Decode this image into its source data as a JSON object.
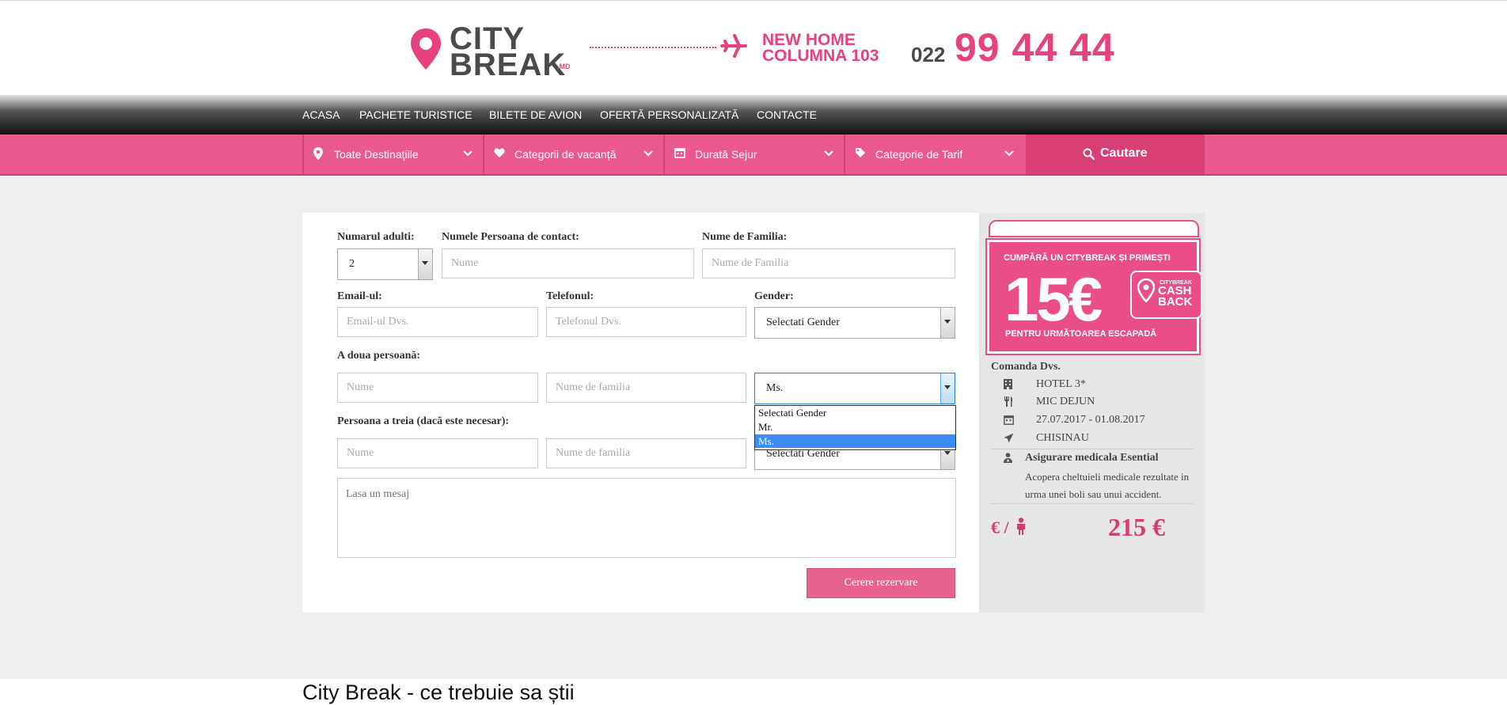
{
  "brand": {
    "logo_line1": "CITY",
    "logo_line2": "BREAK",
    "logo_suffix": ".MD",
    "accent_color": "#e7417f",
    "address_line1": "NEW HOME",
    "address_line2": "COLUMNA 103",
    "phone_prefix": "022",
    "phone_number": "99 44 44"
  },
  "nav": {
    "items": [
      "ACASA",
      "PACHETE TURISTICE",
      "BILETE DE AVION",
      "OFERTĂ PERSONALIZATĂ",
      "CONTACTE"
    ]
  },
  "filters": {
    "items": [
      {
        "label": "Toate Destinaţiile",
        "icon": "map-marker-icon"
      },
      {
        "label": "Categorii de vacanță",
        "icon": "heart-icon"
      },
      {
        "label": "Durată Sejur",
        "icon": "calendar-icon"
      },
      {
        "label": "Categorie de Tarif",
        "icon": "tag-icon"
      }
    ],
    "search_label": "Cautare"
  },
  "form": {
    "adults_label": "Numarul adulti:",
    "adults_value": "2",
    "contact_name_label": "Numele Persoana de contact:",
    "contact_name_placeholder": "Nume",
    "family_name_label": "Nume de Familia:",
    "family_name_placeholder": "Nume de Familia",
    "email_label": "Email-ul:",
    "email_placeholder": "Email-ul Dvs.",
    "phone_label": "Telefonul:",
    "phone_placeholder": "Telefonul Dvs.",
    "gender_label": "Gender:",
    "gender_value": "Selectati Gender",
    "second_person_label": "A doua persoană:",
    "second_name_placeholder": "Nume",
    "second_family_placeholder": "Nume de familia",
    "second_gender_value": "Ms.",
    "gender_options": [
      "Selectati Gender",
      "Mr.",
      "Ms."
    ],
    "third_person_label": "Persoana a treia (dacă este necesar):",
    "third_name_placeholder": "Nume",
    "third_family_placeholder": "Nume de familia",
    "third_gender_value": "Selectati Gender",
    "message_placeholder": "Lasa un mesaj",
    "submit_label": "Cerere rezervare"
  },
  "banner": {
    "top_text": "CUMPĂRĂ UN CITYBREAK ȘI PRIMEȘTI",
    "amount": "15€",
    "cashback_small": "CITYBREAK",
    "cashback_line1": "CASH",
    "cashback_line2": "BACK",
    "bottom_text": "PENTRU URMĂTOAREA ESCAPADĂ"
  },
  "order": {
    "title": "Comanda Dvs.",
    "items": [
      {
        "icon": "building-icon",
        "text": "HOTEL 3*"
      },
      {
        "icon": "cutlery-icon",
        "text": "MIC DEJUN"
      },
      {
        "icon": "calendar-icon",
        "text": "27.07.2017 - 01.08.2017"
      },
      {
        "icon": "plane-icon",
        "text": "CHISINAU"
      }
    ],
    "insurance_title": "Asigurare medicala Esential",
    "insurance_desc": "Acopera cheltuieli medicale rezultate in urma unei boli sau unui accident.",
    "price_unit": "€ /",
    "price": "215 €"
  },
  "footer": {
    "section_title": "City Break - ce trebuie sa știi"
  }
}
